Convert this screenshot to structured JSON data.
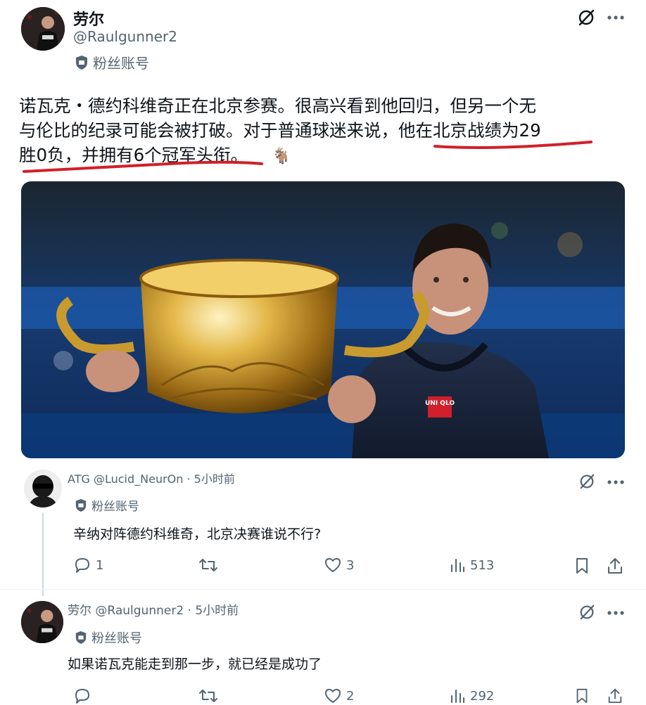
{
  "main_post": {
    "display_name": "劳尔",
    "handle": "@Raulgunner2",
    "badge": "粉丝账号",
    "text_lines": [
      "诺瓦克・德约科维奇正在北京参赛。很高兴看到他回归，但另一个无",
      "与伦比的纪录可能会被打破。对于普通球迷来说，他在北京战绩为29",
      "胜0负，并拥有6个冠军头衔。"
    ],
    "emoji": "🐐"
  },
  "reply1": {
    "header": "ATG @Lucid_NeurOn · 5小时前",
    "badge": "粉丝账号",
    "text": "辛纳对阵德约科维奇，北京决赛谁说不行?",
    "replies": "1",
    "retweets": "",
    "likes": "3",
    "views": "513"
  },
  "reply2": {
    "header": "劳尔 @Raulgunner2 · 5小时前",
    "badge": "粉丝账号",
    "text": "如果诺瓦克能走到那一步，就已经是成功了",
    "replies": "",
    "retweets": "",
    "likes": "2",
    "views": "292"
  },
  "photo": {
    "shirt_text": "UNI QLO"
  },
  "colors": {
    "annotation_red": "#d0202a",
    "muted": "#536471",
    "text": "#0f1419",
    "divider": "#eff3f4"
  },
  "icons": [
    "grok-icon",
    "more-icon",
    "shield-icon",
    "reply-icon",
    "retweet-icon",
    "like-icon",
    "views-icon",
    "bookmark-icon",
    "share-icon"
  ]
}
